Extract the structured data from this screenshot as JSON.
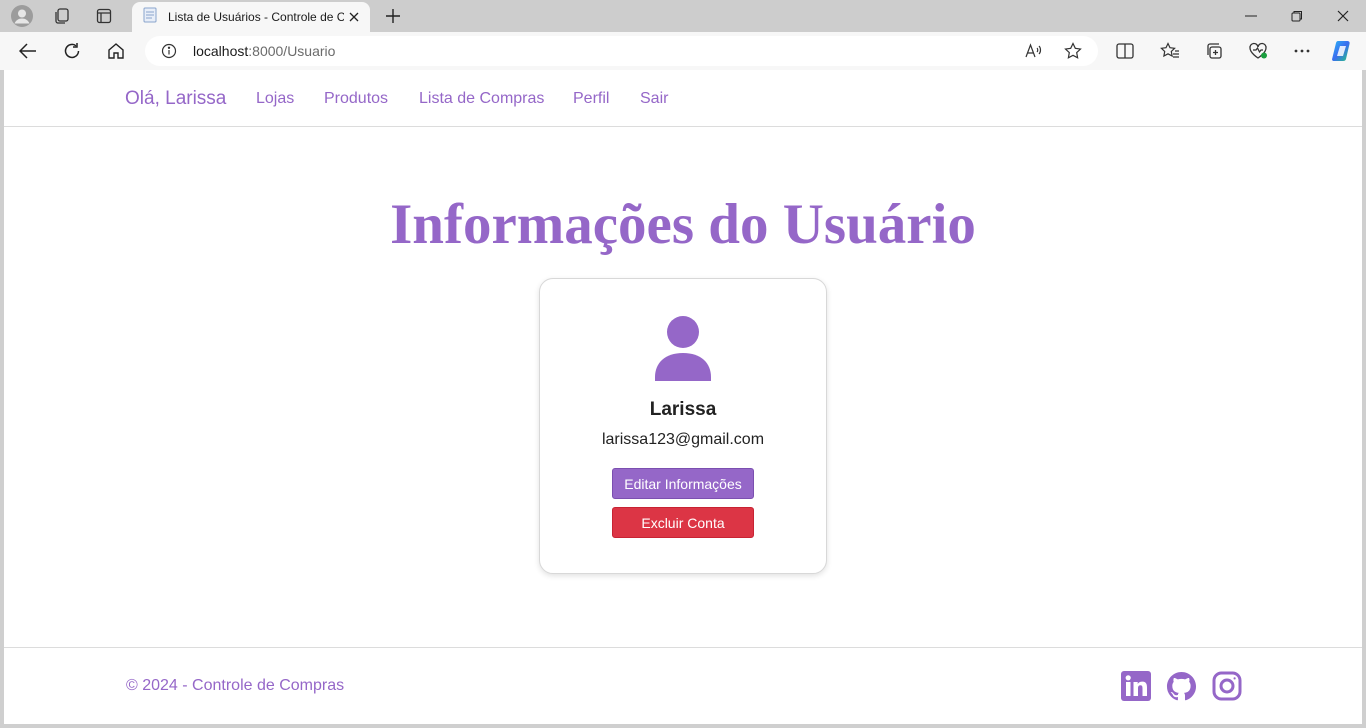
{
  "browser": {
    "tab_title": "Lista de Usuários - Controle de C",
    "url_host": "localhost",
    "url_path": ":8000/Usuario"
  },
  "navbar": {
    "brand": "Olá, Larissa",
    "links": [
      "Lojas",
      "Produtos",
      "Lista de Compras",
      "Perfil",
      "Sair"
    ]
  },
  "main": {
    "title": "Informações do Usuário",
    "user": {
      "name": "Larissa",
      "email": "larissa123@gmail.com"
    },
    "edit_button": "Editar Informações",
    "delete_button": "Excluir Conta"
  },
  "footer": {
    "copyright": "© 2024 - Controle de Compras",
    "social_icons": [
      "linkedin-icon",
      "github-icon",
      "instagram-icon"
    ]
  },
  "colors": {
    "accent": "#9567c8",
    "danger": "#dc3545"
  }
}
